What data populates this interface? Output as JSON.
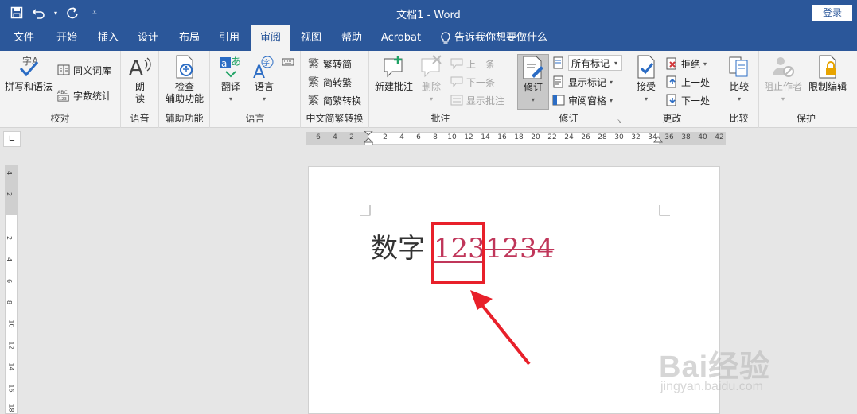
{
  "titlebar": {
    "title": "文档1  -  Word",
    "login": "登录",
    "qat_icons": [
      "save-icon",
      "undo-icon",
      "redo-icon",
      "customize-qat-icon"
    ]
  },
  "tabs": [
    "文件",
    "开始",
    "插入",
    "设计",
    "布局",
    "引用",
    "审阅",
    "视图",
    "帮助",
    "Acrobat"
  ],
  "active_tab": "审阅",
  "tell_me": "告诉我你想要做什么",
  "ribbon": {
    "proofing": {
      "label": "校对",
      "spelling": "拼写和语法",
      "thesaurus": "同义词库",
      "word_count": "字数统计"
    },
    "speech": {
      "label": "语音",
      "read_aloud_1": "朗",
      "read_aloud_2": "读"
    },
    "accessibility": {
      "label": "辅助功能",
      "check_1": "检查",
      "check_2": "辅助功能"
    },
    "language": {
      "label": "语言",
      "translate": "翻译",
      "language": "语言"
    },
    "chinese_conv": {
      "label": "中文简繁转换",
      "trad_to_simp": "繁转简",
      "simp_to_trad": "简转繁",
      "conversion": "简繁转换"
    },
    "comments": {
      "label": "批注",
      "new": "新建批注",
      "delete": "删除",
      "prev": "上一条",
      "next": "下一条",
      "show": "显示批注"
    },
    "tracking": {
      "label": "修订",
      "track": "修订",
      "markup": "所有标记",
      "show_markup": "显示标记",
      "pane": "审阅窗格"
    },
    "changes": {
      "label": "更改",
      "accept": "接受",
      "reject": "拒绝",
      "prev": "上一处",
      "next": "下一处"
    },
    "compare": {
      "label": "比较",
      "compare": "比较"
    },
    "protect": {
      "label": "保护",
      "block": "阻止作者",
      "restrict": "限制编辑"
    }
  },
  "hruler": [
    "6",
    "4",
    "2",
    "2",
    "4",
    "6",
    "8",
    "10",
    "12",
    "14",
    "16",
    "18",
    "20",
    "22",
    "24",
    "26",
    "28",
    "30",
    "32",
    "34",
    "36",
    "38",
    "40",
    "42"
  ],
  "vruler": [
    "4",
    "2",
    "2",
    "4",
    "6",
    "8",
    "10",
    "12",
    "14",
    "16",
    "18"
  ],
  "document": {
    "plain": "数字 ",
    "inserted": "123",
    "deleted": "1234"
  },
  "watermark": {
    "brand": "Bai经验",
    "url": "jingyan.baidu.com"
  },
  "colors": {
    "brand": "#2b579a",
    "revision": "#c0365a",
    "highlight": "#e8202a"
  }
}
